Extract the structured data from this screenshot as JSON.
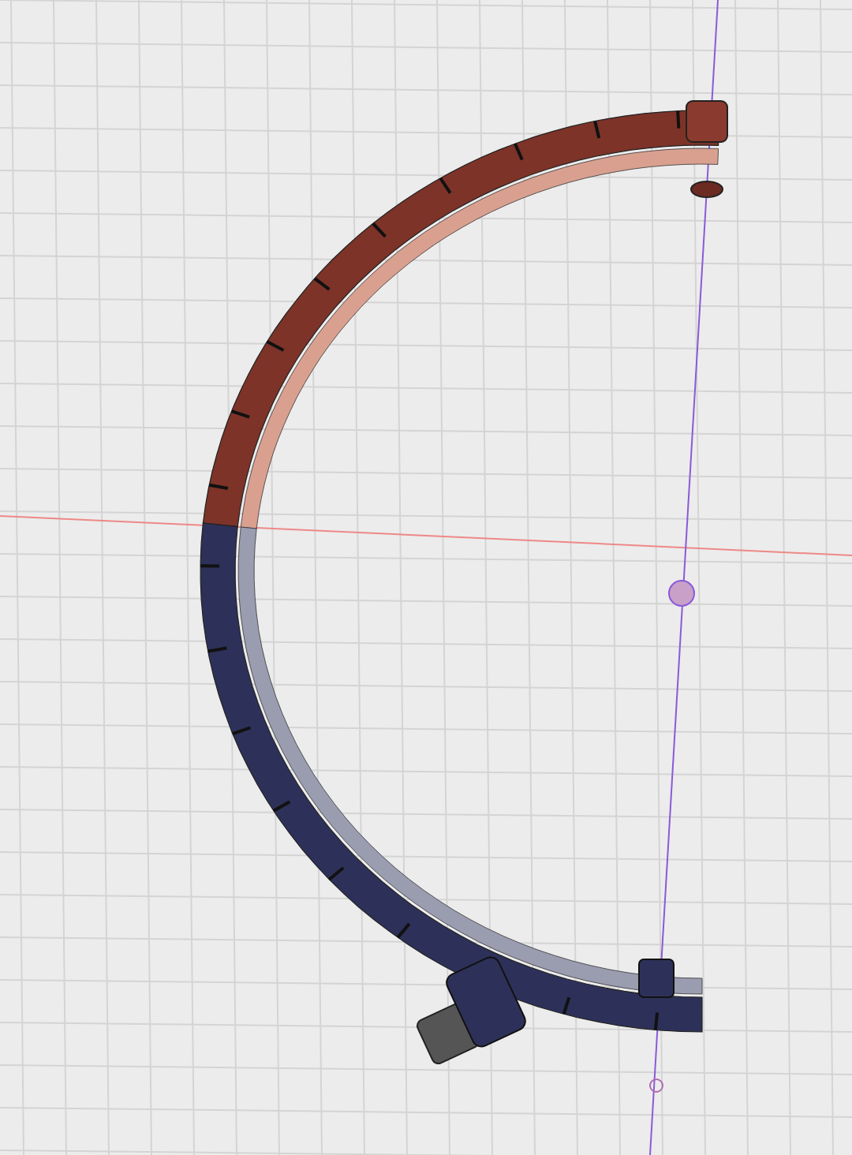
{
  "model": {
    "segments": [
      {
        "color": "#7d3328"
      },
      {
        "color": "#2d3159"
      }
    ]
  }
}
